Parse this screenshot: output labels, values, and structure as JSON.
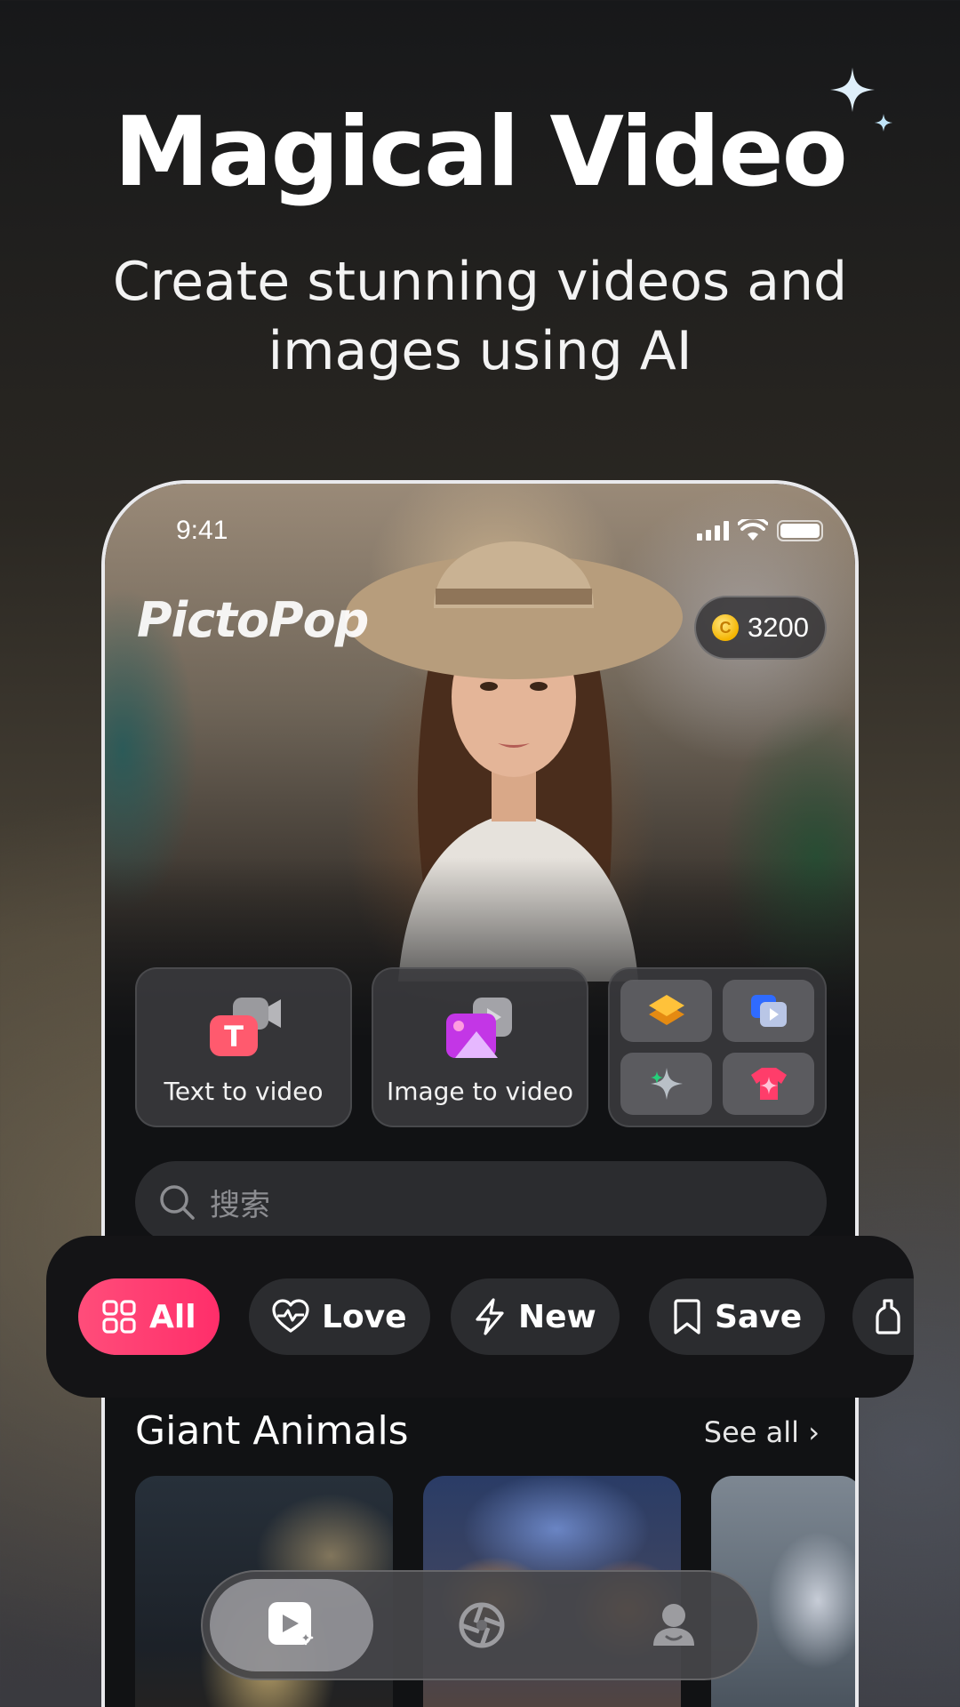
{
  "promo": {
    "headline": "Magical Video",
    "subline": "Create stunning videos and images using AI"
  },
  "status_bar": {
    "time": "9:41"
  },
  "app": {
    "logo_text": "PictoPop",
    "coins": "3200",
    "coin_symbol": "C"
  },
  "features": {
    "text_to_video": "Text to video",
    "image_to_video": "Image to video",
    "tools_icons": [
      "layers-icon",
      "video-play-icon",
      "sparkle-icon",
      "shirt-icon"
    ]
  },
  "search": {
    "placeholder": "搜索"
  },
  "filters": [
    {
      "label": "All",
      "icon": "grid-icon",
      "active": true
    },
    {
      "label": "Love",
      "icon": "heart-pulse-icon",
      "active": false
    },
    {
      "label": "New",
      "icon": "lightning-icon",
      "active": false
    },
    {
      "label": "Save",
      "icon": "bookmark-icon",
      "active": false
    },
    {
      "label": "",
      "icon": "bottle-icon",
      "active": false
    }
  ],
  "section": {
    "title": "Giant Animals",
    "see_all": "See all ›"
  },
  "bottom_nav": [
    {
      "icon": "video-create-icon",
      "active": true
    },
    {
      "icon": "camera-aperture-icon",
      "active": false
    },
    {
      "icon": "profile-icon",
      "active": false
    }
  ],
  "colors": {
    "accent": "#ff3d70",
    "coin": "#f4b400",
    "surface": "#2b2c2f"
  }
}
